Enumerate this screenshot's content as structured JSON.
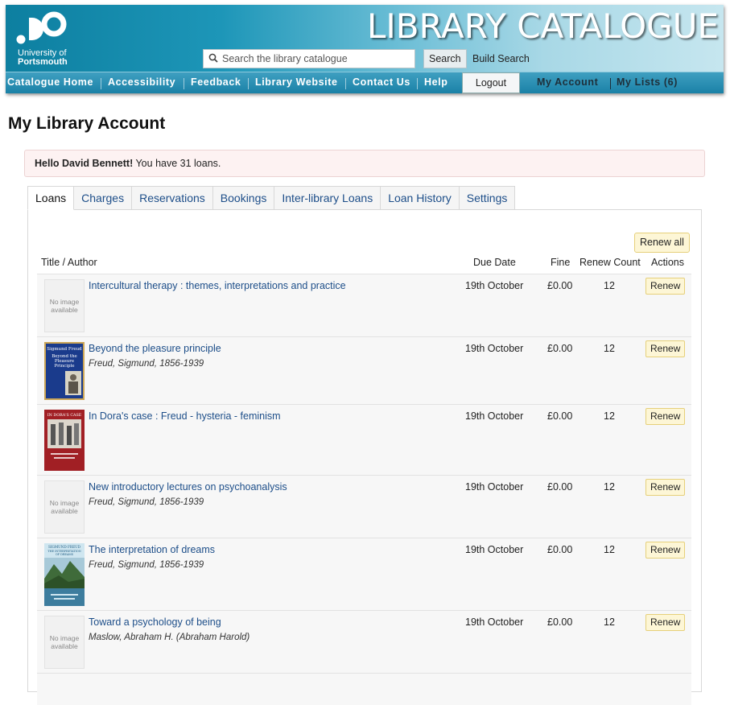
{
  "header": {
    "logo_line1": "University of",
    "logo_line2": "Portsmouth",
    "title": "LIBRARY CATALOGUE",
    "search_placeholder": "Search the library catalogue",
    "search_button": "Search",
    "build_search": "Build Search"
  },
  "nav": {
    "items": [
      "Catalogue Home",
      "Accessibility",
      "Feedback",
      "Library Website",
      "Contact Us",
      "Help"
    ],
    "logout": "Logout",
    "my_account": "My Account",
    "my_lists": "My Lists (6)"
  },
  "page": {
    "title": "My Library Account",
    "greeting_name": "Hello David Bennett!",
    "greeting_rest": " You have 31 loans."
  },
  "tabs": [
    "Loans",
    "Charges",
    "Reservations",
    "Bookings",
    "Inter-library Loans",
    "Loan History",
    "Settings"
  ],
  "loans": {
    "renew_all": "Renew all",
    "headers": {
      "title_author": "Title / Author",
      "due_date": "Due Date",
      "fine": "Fine",
      "renew_count": "Renew Count",
      "actions": "Actions"
    },
    "no_image_text": "No image available",
    "rows": [
      {
        "title": "Intercultural therapy : themes, interpretations and practice",
        "author": "",
        "due": "19th October",
        "fine": "£0.00",
        "count": "12",
        "action": "Renew",
        "cover": "none"
      },
      {
        "title": "Beyond the pleasure principle",
        "author": "Freud, Sigmund, 1856-1939",
        "due": "19th October",
        "fine": "£0.00",
        "count": "12",
        "action": "Renew",
        "cover": "beyond-pleasure"
      },
      {
        "title": "In Dora's case : Freud - hysteria - feminism",
        "author": "",
        "due": "19th October",
        "fine": "£0.00",
        "count": "12",
        "action": "Renew",
        "cover": "doras-case"
      },
      {
        "title": "New introductory lectures on psychoanalysis",
        "author": "Freud, Sigmund, 1856-1939",
        "due": "19th October",
        "fine": "£0.00",
        "count": "12",
        "action": "Renew",
        "cover": "none"
      },
      {
        "title": "The interpretation of dreams",
        "author": "Freud, Sigmund, 1856-1939",
        "due": "19th October",
        "fine": "£0.00",
        "count": "12",
        "action": "Renew",
        "cover": "interpretation-dreams"
      },
      {
        "title": "Toward a psychology of being",
        "author": "Maslow, Abraham H. (Abraham Harold)",
        "due": "19th October",
        "fine": "£0.00",
        "count": "12",
        "action": "Renew",
        "cover": "none"
      }
    ],
    "cover_texts": {
      "beyond": [
        "Sigmund Freud",
        "Beyond the",
        "Pleasure",
        "Principle"
      ],
      "dora": "IN DORA'S CASE",
      "dreams": [
        "SIGMUND FREUD",
        "THE INTERPRETATION",
        "OF DREAMS"
      ]
    }
  },
  "colors": {
    "header_start": "#0d7fa0",
    "header_end": "#c6e6ef",
    "link": "#1d4e89",
    "renew_bg": "#fdf6d6",
    "alert_bg": "#fdf2f2"
  }
}
